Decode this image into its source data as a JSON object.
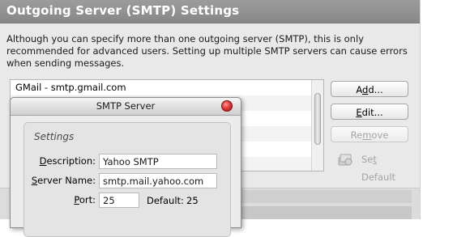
{
  "header": {
    "title": "Outgoing Server (SMTP) Settings"
  },
  "description": "Although you can specify more than one outgoing server (SMTP), this is only recommended for advanced users. Setting up multiple SMTP servers can cause errors when sending messages.",
  "server_list": {
    "items": [
      {
        "label": "GMail - smtp.gmail.com"
      }
    ]
  },
  "buttons": {
    "add": {
      "pre": "A",
      "key": "d",
      "post": "d..."
    },
    "edit": {
      "pre": "",
      "key": "E",
      "post": "dit..."
    },
    "remove": {
      "pre": "Re",
      "key": "m",
      "post": "ove"
    },
    "set_default": {
      "pre": "Se",
      "key": "t",
      "post": " Default"
    }
  },
  "dialog": {
    "title": "SMTP Server",
    "group_title": "Settings",
    "description": {
      "label_pre": "",
      "label_key": "D",
      "label_post": "escription:",
      "value": "Yahoo SMTP"
    },
    "server_name": {
      "label_pre": "",
      "label_key": "S",
      "label_post": "erver Name:",
      "value": "smtp.mail.yahoo.com"
    },
    "port": {
      "label_pre": "",
      "label_key": "P",
      "label_post": "ort:",
      "value": "25"
    },
    "default_port": {
      "label": "Default:",
      "value": "25"
    }
  },
  "icons": {
    "close": "close-icon",
    "set_default": "server-default-icon"
  }
}
